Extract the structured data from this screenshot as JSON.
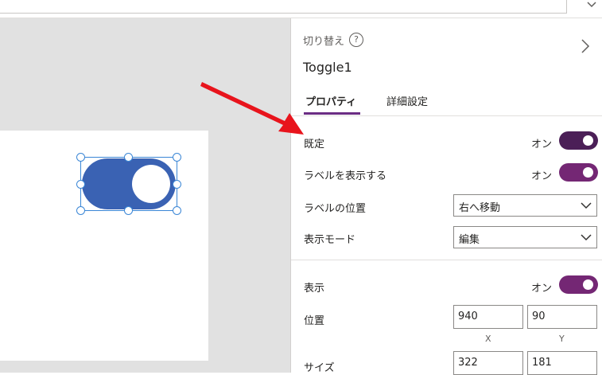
{
  "panel": {
    "control_type": "切り替え",
    "help_glyph": "?",
    "control_name": "Toggle1",
    "tabs": [
      {
        "label": "プロパティ",
        "active": true
      },
      {
        "label": "詳細設定",
        "active": false
      }
    ],
    "properties": {
      "default": {
        "label": "既定",
        "state": "オン",
        "color": "#4b1f57"
      },
      "show_label": {
        "label": "ラベルを表示する",
        "state": "オン",
        "color": "#742774"
      },
      "label_position": {
        "label": "ラベルの位置",
        "value": "右へ移動"
      },
      "display_mode": {
        "label": "表示モード",
        "value": "編集"
      },
      "visible": {
        "label": "表示",
        "state": "オン",
        "color": "#742774"
      },
      "position": {
        "label": "位置",
        "x": "940",
        "y": "90",
        "x_caption": "X",
        "y_caption": "Y"
      },
      "size": {
        "label": "サイズ",
        "width": "322",
        "height": "181"
      }
    }
  },
  "canvas": {
    "toggle_color": "#3a62b3",
    "selection_color": "#3a86d6",
    "arrow_color": "#e8141c"
  }
}
